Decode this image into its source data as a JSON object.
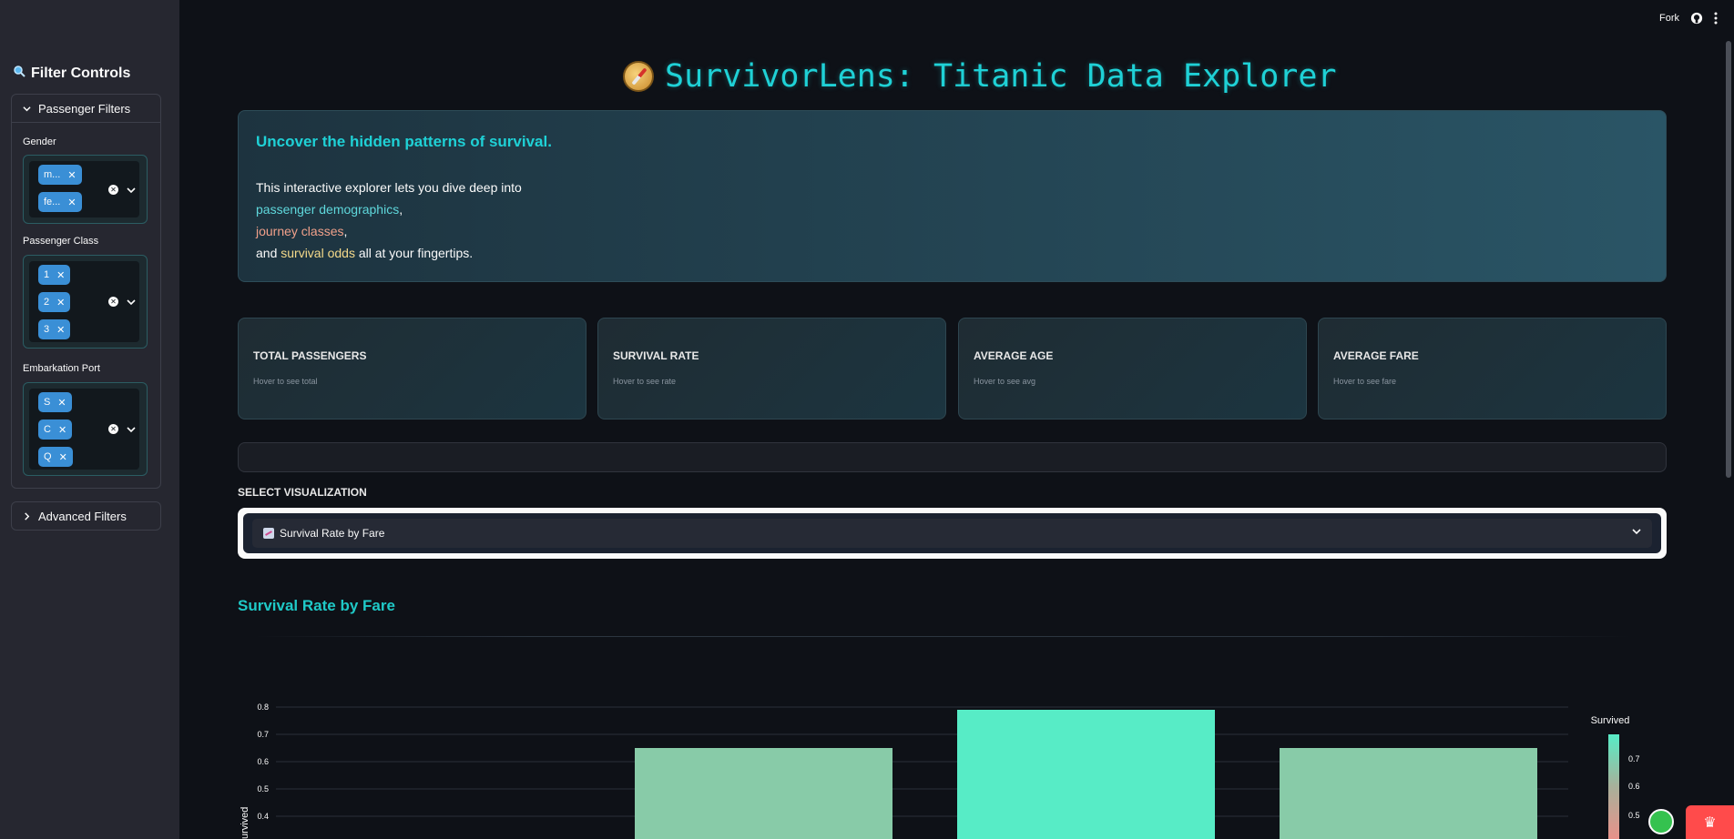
{
  "topbar": {
    "fork_label": "Fork",
    "github_icon": "github-icon",
    "menu_icon": "kebab-menu-icon"
  },
  "sidebar": {
    "title": "Filter Controls",
    "title_icon": "search-icon",
    "passenger_filters": {
      "label": "Passenger Filters",
      "expanded": true,
      "gender": {
        "label": "Gender",
        "tags": [
          "m...",
          "fe..."
        ]
      },
      "passenger_class": {
        "label": "Passenger Class",
        "tags": [
          "1",
          "2",
          "3"
        ]
      },
      "embarkation_port": {
        "label": "Embarkation Port",
        "tags": [
          "S",
          "C",
          "Q"
        ]
      }
    },
    "advanced_filters": {
      "label": "Advanced Filters",
      "expanded": false
    }
  },
  "main": {
    "title": "SurvivorLens: Titanic Data Explorer",
    "title_icon": "compass-icon",
    "intro": {
      "heading": "Uncover the hidden patterns of survival.",
      "line1": "This interactive explorer lets you dive deep into",
      "highlight1": "passenger demographics",
      "comma1": ",",
      "highlight2": "journey classes",
      "comma2": ",",
      "line3_pre": "and ",
      "highlight3": "survival odds",
      "line3_post": " all at your fingertips."
    },
    "metrics": [
      {
        "label": "TOTAL PASSENGERS",
        "hint": "Hover to see total"
      },
      {
        "label": "SURVIVAL RATE",
        "hint": "Hover to see rate"
      },
      {
        "label": "AVERAGE AGE",
        "hint": "Hover to see avg"
      },
      {
        "label": "AVERAGE FARE",
        "hint": "Hover to see fare"
      }
    ],
    "visualization": {
      "label": "SELECT VISUALIZATION",
      "selected": "Survival Rate by Fare",
      "selected_icon": "chart-icon"
    },
    "section_title": "Survival Rate by Fare"
  },
  "colors": {
    "accent": "#1fd1d6",
    "bar_high": "#57ecc6",
    "bar_mid": "#88cba8",
    "tag": "#3a8fd6"
  },
  "chart_data": {
    "type": "bar",
    "ylabel": "Survived",
    "y_ticks": [
      "0.4",
      "0.5",
      "0.6",
      "0.7",
      "0.8"
    ],
    "bars": [
      {
        "value": 0.65
      },
      {
        "value": 0.79
      },
      {
        "value": 0.65
      }
    ],
    "colorbar": {
      "title": "Survived",
      "ticks": [
        "0.7",
        "0.6",
        "0.5"
      ]
    }
  }
}
